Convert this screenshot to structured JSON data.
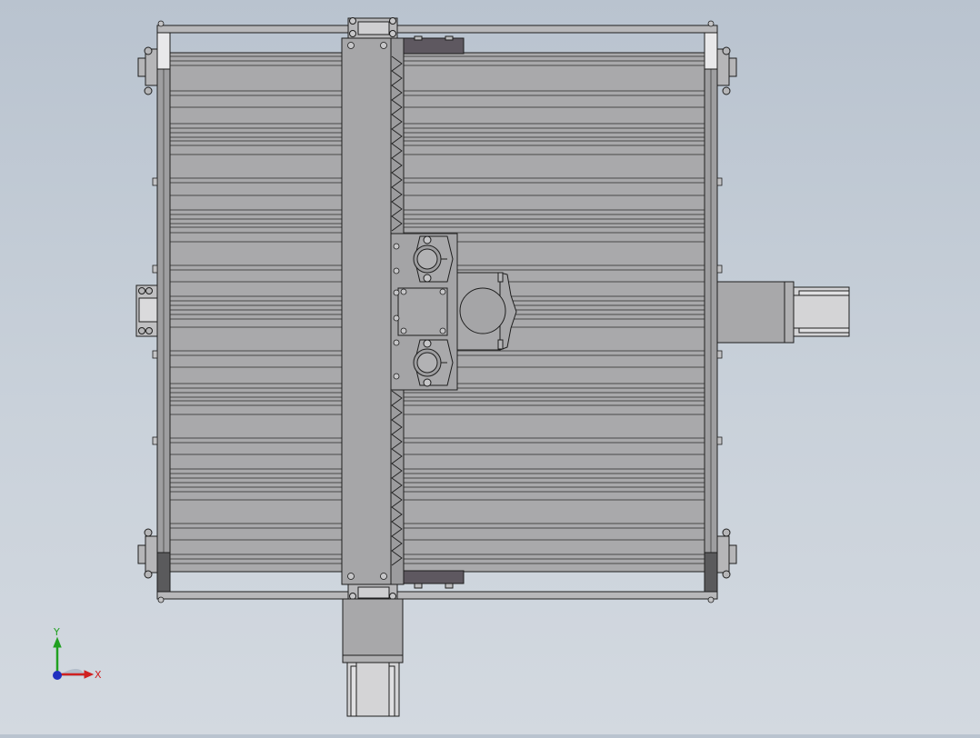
{
  "viewport": {
    "background_top": "#b9c3cf",
    "background_bottom": "#d3d9e0"
  },
  "model": {
    "line_color": "#1e1e1e",
    "body_fill": "#a9a9ab",
    "rail_fill": "#a3a3a5",
    "gantry_fill": "#a6a6a8",
    "motor_fill": "#a8a8aa",
    "dark_plate_fill": "#5e5860"
  },
  "triad": {
    "x_label": "X",
    "y_label": "Y",
    "x_color": "#d02020",
    "y_color": "#20a020",
    "z_color": "#2030c0"
  }
}
